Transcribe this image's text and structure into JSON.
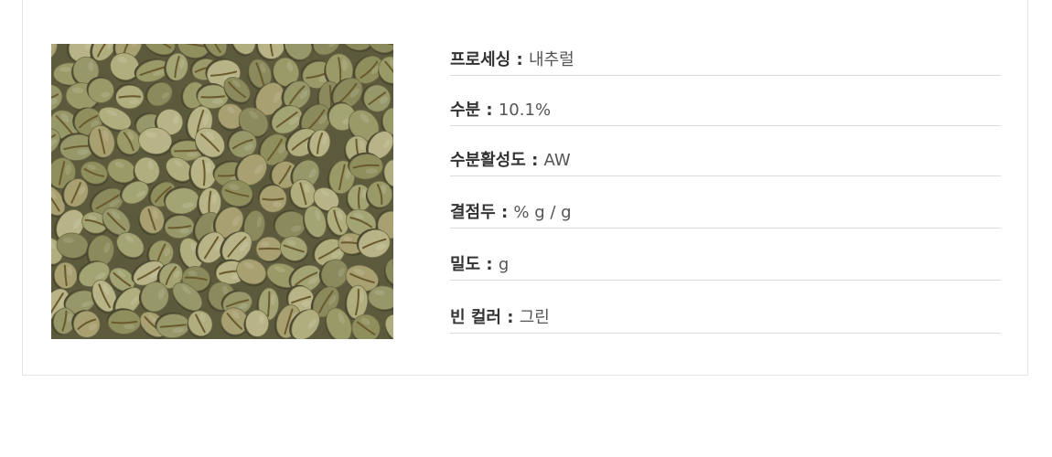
{
  "product_image": {
    "alt": "그린 원두 (생두)",
    "icon": "green-coffee-beans-photo"
  },
  "specs": [
    {
      "label": "프로세싱",
      "separator": " : ",
      "value": "내추럴"
    },
    {
      "label": "수분",
      "separator": " : ",
      "value": "10.1%"
    },
    {
      "label": "수분활성도",
      "separator": " : ",
      "value": "AW"
    },
    {
      "label": "결점두",
      "separator": " :  ",
      "value": "% g / g"
    },
    {
      "label": "밀도",
      "separator": " : ",
      "value": "g"
    },
    {
      "label": "빈 컬러",
      "separator": " : ",
      "value": "그린"
    }
  ],
  "colors": {
    "label": "#333333",
    "value": "#555555",
    "divider": "#dcdcdc",
    "card_border": "#e4e4e4",
    "bean": "#9a9a6c",
    "bean_shadow": "#5c5a3c"
  }
}
